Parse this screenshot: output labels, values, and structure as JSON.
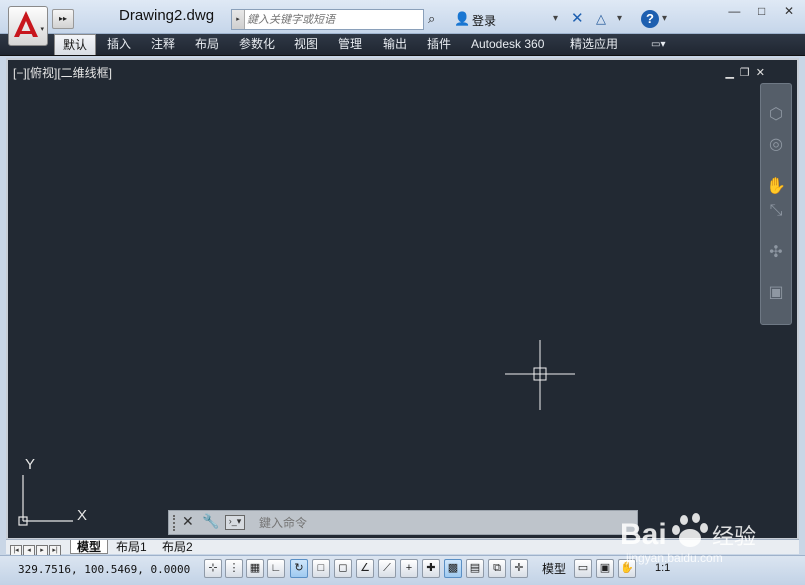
{
  "title_bar": {
    "document_title": "Drawing2.dwg",
    "search_placeholder": "鍵入关键字或短语",
    "login_label": "登录"
  },
  "ribbon": {
    "tabs": [
      "默认",
      "插入",
      "注释",
      "布局",
      "参数化",
      "视图",
      "管理",
      "输出",
      "插件",
      "Autodesk 360",
      "精选应用"
    ],
    "active_tab": "默认"
  },
  "viewport": {
    "label": "[−][俯视][二维线框]"
  },
  "ucs": {
    "x_label": "X",
    "y_label": "Y"
  },
  "command_line": {
    "placeholder": "鍵入命令"
  },
  "layout_tabs": [
    "模型",
    "布局1",
    "布局2"
  ],
  "status_bar": {
    "coordinates": "329.7516, 100.5469, 0.0000",
    "model_label": "模型",
    "scale": "1:1"
  },
  "watermark": {
    "brand": "Baidu经验",
    "url": "jingyan.baidu.com"
  },
  "colors": {
    "canvas": "#222933",
    "app_logo": "#c8161d",
    "ribbon_bg": "#2b3340"
  }
}
